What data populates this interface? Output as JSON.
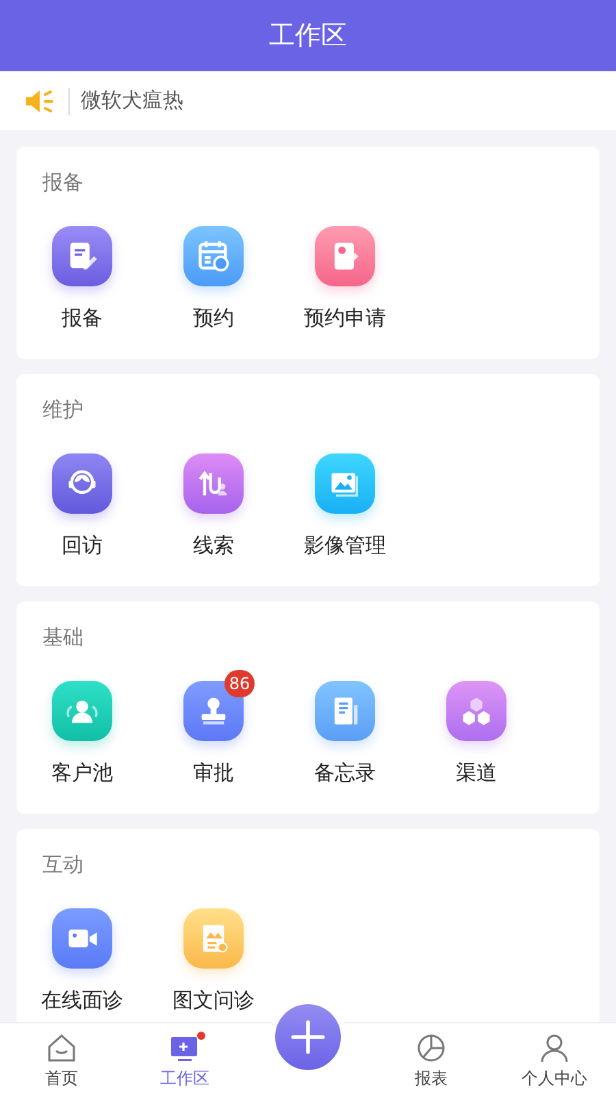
{
  "header": {
    "title": "工作区"
  },
  "notice": {
    "text": "微软犬瘟热"
  },
  "sections": [
    {
      "title": "报备",
      "items": [
        {
          "label": "报备"
        },
        {
          "label": "预约"
        },
        {
          "label": "预约申请"
        }
      ]
    },
    {
      "title": "维护",
      "items": [
        {
          "label": "回访"
        },
        {
          "label": "线索"
        },
        {
          "label": "影像管理"
        }
      ]
    },
    {
      "title": "基础",
      "items": [
        {
          "label": "客户池"
        },
        {
          "label": "审批",
          "badge": "86"
        },
        {
          "label": "备忘录"
        },
        {
          "label": "渠道"
        }
      ]
    },
    {
      "title": "互动",
      "items": [
        {
          "label": "在线面诊"
        },
        {
          "label": "图文问诊"
        }
      ]
    }
  ],
  "tab_bar": [
    {
      "kind": "tab",
      "label": "首页",
      "selected": false,
      "dot": false
    },
    {
      "kind": "tab",
      "label": "工作区",
      "selected": true,
      "dot": true
    },
    {
      "kind": "add"
    },
    {
      "kind": "tab",
      "label": "报表",
      "selected": false,
      "dot": false
    },
    {
      "kind": "tab",
      "label": "个人中心",
      "selected": false,
      "dot": false
    }
  ]
}
